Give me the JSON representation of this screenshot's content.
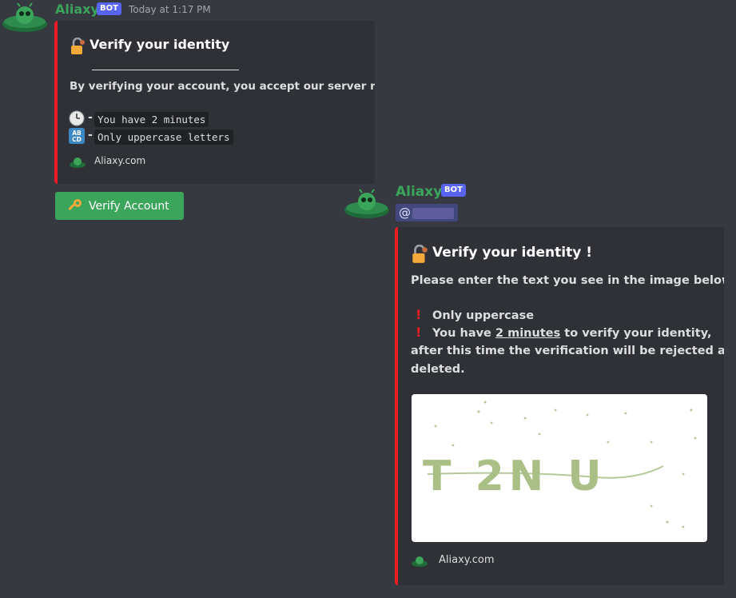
{
  "message1": {
    "username": "Aliaxy",
    "badge": "BOT",
    "timestamp": "Today at 1:17 PM",
    "embed": {
      "title": "Verify your identity",
      "rules_text": "By verifying your account, you accept our server rules!",
      "items": [
        {
          "icon": "clock-icon",
          "text": "You have 2 minutes"
        },
        {
          "icon": "abcd-icon",
          "text": "Only uppercase letters"
        }
      ],
      "dash": "-",
      "footer": "Aliaxy.com"
    },
    "button_label": "Verify Account"
  },
  "message2": {
    "username": "Aliaxy",
    "badge": "BOT",
    "mention": "@",
    "embed": {
      "title": "Verify your identity !",
      "description": "Please enter the text you see in the image below.",
      "notice1": "Only uppercase",
      "notice2_prefix": "You have ",
      "notice2_link": "2 minutes",
      "notice2_suffix": " to verify your identity,",
      "notice3": "after this time the verification will be rejected and",
      "notice4": "deleted.",
      "bang": "!",
      "captcha_text": "T 2N U",
      "footer": "Aliaxy.com"
    }
  },
  "colors": {
    "background": "#36393f",
    "embed_bg": "#2f3136",
    "accent_bar": "#ed1c24",
    "username": "#3ba55c",
    "bot_badge": "#5865f2",
    "button": "#3ba55c",
    "captcha_ink": "#a9bf86"
  }
}
